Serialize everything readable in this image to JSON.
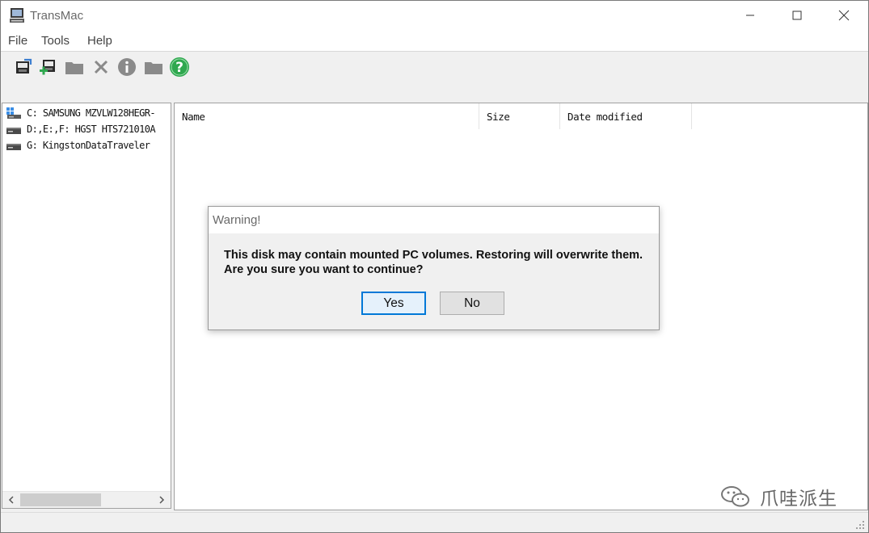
{
  "window": {
    "title": "TransMac",
    "icons": {
      "app": "transmac-computer-icon",
      "minimize": "minimize-icon",
      "maximize": "maximize-icon",
      "close": "close-icon"
    }
  },
  "menu": [
    "File",
    "Tools",
    "Help"
  ],
  "toolbar": [
    {
      "name": "open-disk-image-button",
      "icon": "disk-image-icon"
    },
    {
      "name": "new-disk-image-button",
      "icon": "add-disk-image-icon"
    },
    {
      "name": "folder-button",
      "icon": "folder-icon"
    },
    {
      "name": "delete-button",
      "icon": "delete-x-icon"
    },
    {
      "name": "info-button",
      "icon": "info-icon"
    },
    {
      "name": "new-folder-button",
      "icon": "folder-icon"
    },
    {
      "name": "help-button",
      "icon": "help-question-icon"
    }
  ],
  "drives": [
    {
      "label": "C: SAMSUNG MZVLW128HEGR-",
      "icon": "windows-drive-icon"
    },
    {
      "label": "D:,E:,F: HGST HTS721010A",
      "icon": "hard-drive-icon"
    },
    {
      "label": "G: KingstonDataTraveler",
      "icon": "hard-drive-icon"
    }
  ],
  "file_list": {
    "columns": [
      "Name",
      "Size",
      "Date modified"
    ],
    "rows": []
  },
  "dialog": {
    "title": "Warning!",
    "message_line1": "This disk may contain mounted PC volumes. Restoring will overwrite them.",
    "message_line2": "Are you sure you want to continue?",
    "yes_label": "Yes",
    "no_label": "No"
  },
  "watermark": {
    "text": "爪哇派生",
    "icon": "wechat-icon"
  },
  "colors": {
    "accent": "#0078d7",
    "help_green": "#2fa84f",
    "toolbar_icon_gray": "#8a8a8a"
  }
}
